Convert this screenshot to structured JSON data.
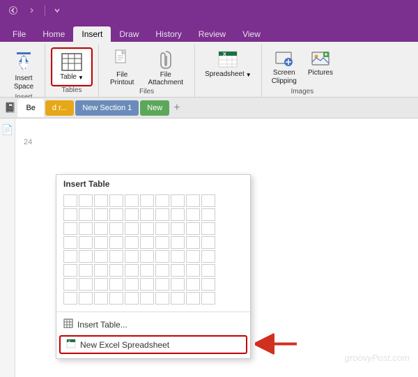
{
  "titlebar": {
    "back_tooltip": "Back",
    "forward_tooltip": "Forward",
    "dropdown_tooltip": "Customize Quick Access Toolbar"
  },
  "tabs": {
    "items": [
      {
        "label": "File",
        "active": false
      },
      {
        "label": "Home",
        "active": false
      },
      {
        "label": "Insert",
        "active": true
      },
      {
        "label": "Draw",
        "active": false
      },
      {
        "label": "History",
        "active": false
      },
      {
        "label": "Review",
        "active": false
      },
      {
        "label": "View",
        "active": false
      }
    ]
  },
  "ribbon": {
    "groups": [
      {
        "name": "Insert",
        "items": [
          {
            "label": "Insert\nSpace",
            "icon": "insert-space"
          }
        ]
      },
      {
        "name": "Tables",
        "items": [
          {
            "label": "Table",
            "icon": "table",
            "highlighted": true,
            "has_dropdown": true
          }
        ]
      },
      {
        "name": "Files",
        "items": [
          {
            "label": "File\nPrintout",
            "icon": "file-printout"
          },
          {
            "label": "File\nAttachment",
            "icon": "file-attachment"
          }
        ]
      },
      {
        "name": "Spreadsheet",
        "items": [
          {
            "label": "Spreadsheet",
            "icon": "spreadsheet",
            "has_dropdown": true
          }
        ]
      },
      {
        "name": "Images",
        "items": [
          {
            "label": "Screen\nClipping",
            "icon": "screen-clipping"
          },
          {
            "label": "Pictures",
            "icon": "pictures"
          }
        ]
      }
    ]
  },
  "notebook": {
    "title": "Be",
    "sections": [
      {
        "label": "d r...",
        "color": "#E6A817"
      },
      {
        "label": "New Section 1",
        "color": "#6B8CBA"
      },
      {
        "label": "New",
        "color": "#5BA85A"
      }
    ],
    "line_number": "24"
  },
  "dropdown": {
    "title": "Insert Table",
    "grid_rows": 8,
    "grid_cols": 10,
    "items": [
      {
        "label": "Insert Table...",
        "icon": "table-icon"
      },
      {
        "label": "New Excel Spreadsheet",
        "icon": "excel-icon",
        "highlighted": true
      }
    ]
  },
  "watermark": {
    "text": "groovyPost.com"
  }
}
